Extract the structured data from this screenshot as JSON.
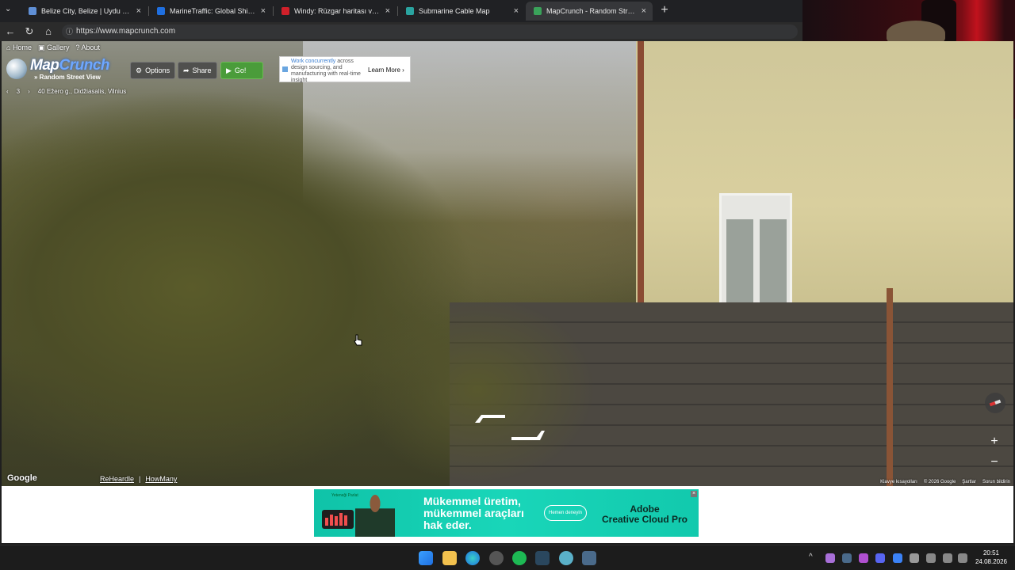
{
  "browser": {
    "tabs": [
      {
        "title": "Belize City, Belize | Uydu ve radar",
        "active": false,
        "favicon_color": "#5f8fd6"
      },
      {
        "title": "MarineTraffic: Global Ship Tracking",
        "active": false,
        "favicon_color": "#1f6fe0"
      },
      {
        "title": "Windy: Rüzgar haritası ve hava tah",
        "active": false,
        "favicon_color": "#d0202a"
      },
      {
        "title": "Submarine Cable Map",
        "active": false,
        "favicon_color": "#2aa4a0"
      },
      {
        "title": "MapCrunch - Random Street View",
        "active": true,
        "favicon_color": "#3aa25a"
      }
    ],
    "url": "https://www.mapcrunch.com"
  },
  "mapcrunch": {
    "top_links": {
      "home": "Home",
      "gallery": "Gallery",
      "about": "About"
    },
    "logo": {
      "map": "Map",
      "crunch": "Crunch",
      "sub": "» Random Street View"
    },
    "buttons": {
      "options": "Options",
      "share": "Share",
      "go": "Go!"
    },
    "location": {
      "count": "3",
      "address": "40 Ežero g., Didžiasalis, Vilnius"
    },
    "footer": {
      "google": "Google",
      "reheardle": "ReHeardle",
      "sep": "|",
      "howmany": "HowMany",
      "attribution": [
        "Klavye kısayolları",
        "© 2026 Google",
        "Şartlar",
        "Sorun bildirin"
      ]
    }
  },
  "ads": {
    "top": {
      "headline": "Work concurrently",
      "body": "across design sourcing, and manufacturing with real-time insight",
      "cta": "Learn More"
    },
    "bottom": {
      "brand": "Yeteneği Parlat",
      "headline_lines": [
        "Mükemmel üretim,",
        "mükemmel araçları",
        "hak eder."
      ],
      "cta": "Hemen deneyin",
      "product_lines": [
        "Adobe",
        "Creative Cloud Pro"
      ]
    }
  },
  "system": {
    "time": "20:51",
    "date": "24.08.2026"
  }
}
